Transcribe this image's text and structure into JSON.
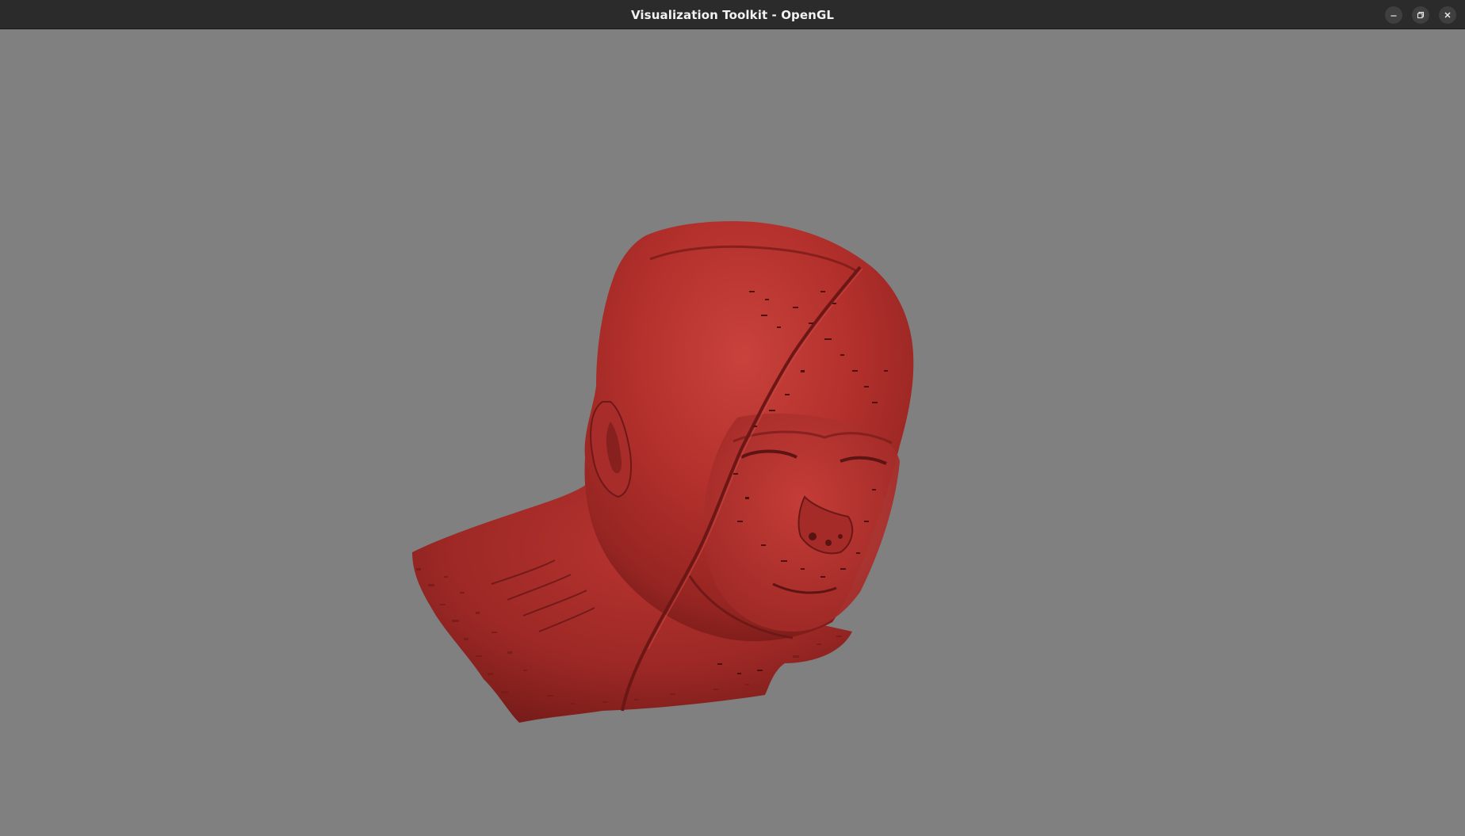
{
  "window": {
    "title": "Visualization Toolkit - OpenGL",
    "controls": {
      "minimize_icon": "minimize-icon",
      "restore_icon": "restore-icon",
      "close_icon": "close-icon"
    }
  },
  "viewport": {
    "background_color": "#808080",
    "model_color": "#b02a2a"
  }
}
